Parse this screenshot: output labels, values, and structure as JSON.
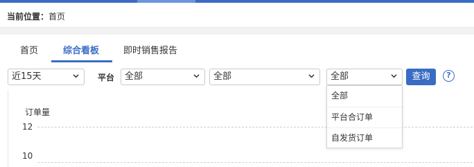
{
  "breadcrumb": {
    "label": "当前位置：",
    "current": "首页"
  },
  "tabs": [
    {
      "label": "首页"
    },
    {
      "label": "综合看板"
    },
    {
      "label": "即时销售报告"
    }
  ],
  "filters": {
    "period": "近15天",
    "platform_label": "平台",
    "platform": "全部",
    "secondary": "全部",
    "order_type": "全部",
    "query_button": "查询",
    "help": "?"
  },
  "order_type_dropdown": {
    "options": [
      "全部",
      "平台合订单",
      "自发货订单"
    ]
  },
  "chart_data": {
    "type": "line",
    "ylabel": "订单量",
    "yticks": [
      "12",
      "10"
    ],
    "grid": true
  },
  "colors": {
    "accent": "#3a6cc4"
  },
  "icons": {
    "chevron": "chevron-down-icon",
    "help": "help-circle-icon"
  }
}
